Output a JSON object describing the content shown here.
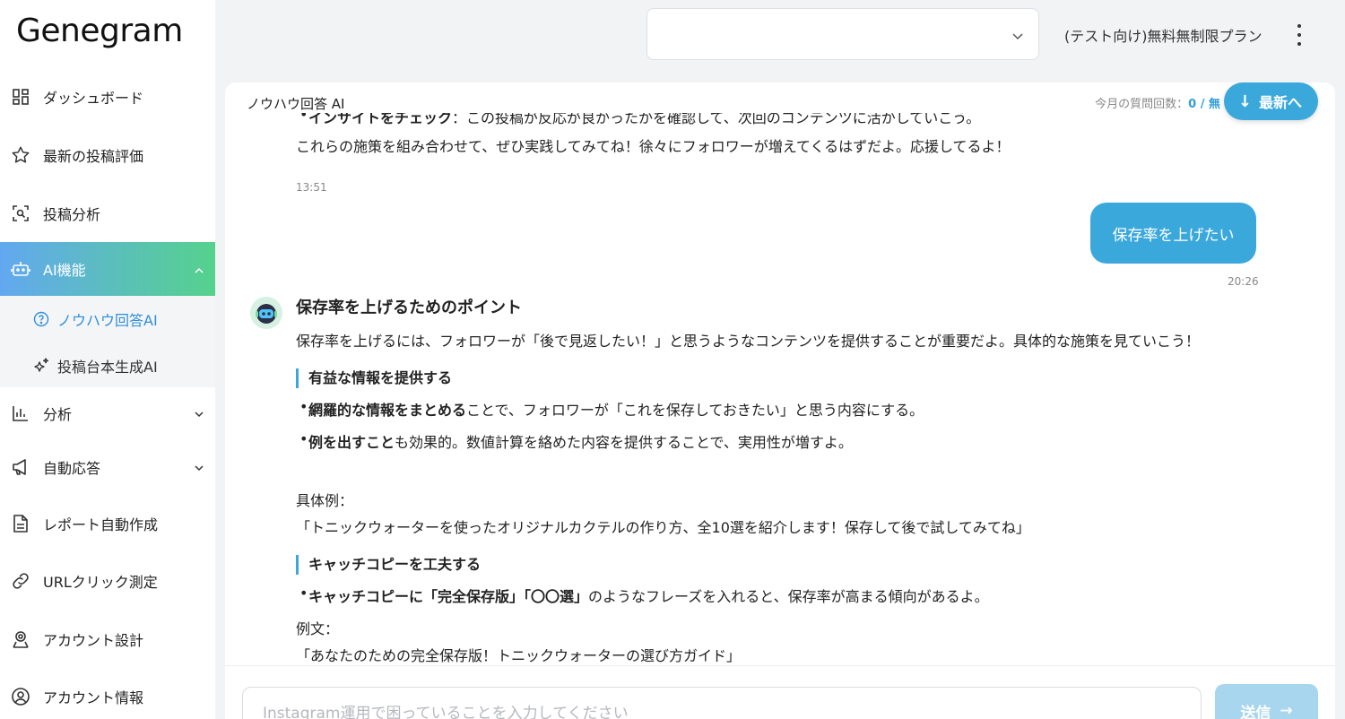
{
  "app": {
    "logo": "Genegram"
  },
  "sidebar": {
    "items": [
      {
        "label": "ダッシュボード",
        "icon": "dashboard-icon"
      },
      {
        "label": "最新の投稿評価",
        "icon": "star-icon"
      },
      {
        "label": "投稿分析",
        "icon": "scan-search-icon"
      },
      {
        "label": "AI機能",
        "icon": "robot-icon"
      },
      {
        "label": "分析",
        "icon": "bar-chart-icon"
      },
      {
        "label": "自動応答",
        "icon": "megaphone-icon"
      },
      {
        "label": "レポート自動作成",
        "icon": "document-icon"
      },
      {
        "label": "URLクリック測定",
        "icon": "link-icon"
      },
      {
        "label": "アカウント設計",
        "icon": "user-location-icon"
      },
      {
        "label": "アカウント情報",
        "icon": "user-circle-icon"
      }
    ],
    "sub_items": [
      {
        "label": "ノウハウ回答AI",
        "icon": "question-circle-icon"
      },
      {
        "label": "投稿台本生成AI",
        "icon": "sparkles-icon"
      }
    ]
  },
  "header": {
    "select_value": "",
    "plan": "(テスト向け)無料無制限プラン"
  },
  "chat": {
    "title": "ノウハウ回答 AI",
    "quota_label": "今月の質問回数：",
    "quota_value": "0 / 無",
    "latest_button": "最新へ",
    "prev_message": "これらの施策を組み合わせて、ぜひ実践してみてね！徐々にフォロワーが増えてくるはずだよ。応援してるよ！",
    "prev_time": "13:51",
    "user_message": "保存率を上げたい",
    "user_time": "20:26",
    "answer": {
      "title": "保存率を上げるためのポイント",
      "intro": "保存率を上げるには、フォロワーが「後で見返したい！」と思うようなコンテンツを提供することが重要だよ。具体的な施策を見ていこう！",
      "sec1_title": "有益な情報を提供する",
      "sec1_b1_bold": "網羅的な情報をまとめる",
      "sec1_b1_rest": "ことで、フォロワーが「これを保存しておきたい」と思う内容にする。",
      "sec1_b2_bold": "例を出すこと",
      "sec1_b2_rest": "も効果的。数値計算を絡めた内容を提供することで、実用性が増すよ。",
      "example_label": "具体例：",
      "example_text": "「トニックウォーターを使ったオリジナルカクテルの作り方、全10選を紹介します！保存して後で試してみてね」",
      "sec2_title": "キャッチコピーを工夫する",
      "sec2_b1_bold": "キャッチコピーに「完全保存版」「〇〇選」",
      "sec2_b1_rest": "のようなフレーズを入れると、保存率が高まる傾向があるよ。",
      "sample_label": "例文：",
      "sample_text": "「あなたのための完全保存版！トニックウォーターの選び方ガイド」"
    },
    "input_placeholder": "Instagram運用で困っていることを入力してください",
    "send_label": "送信"
  },
  "colors": {
    "accent": "#3ba8dc",
    "gradient_start": "#62a8f0",
    "gradient_end": "#55d28d"
  }
}
